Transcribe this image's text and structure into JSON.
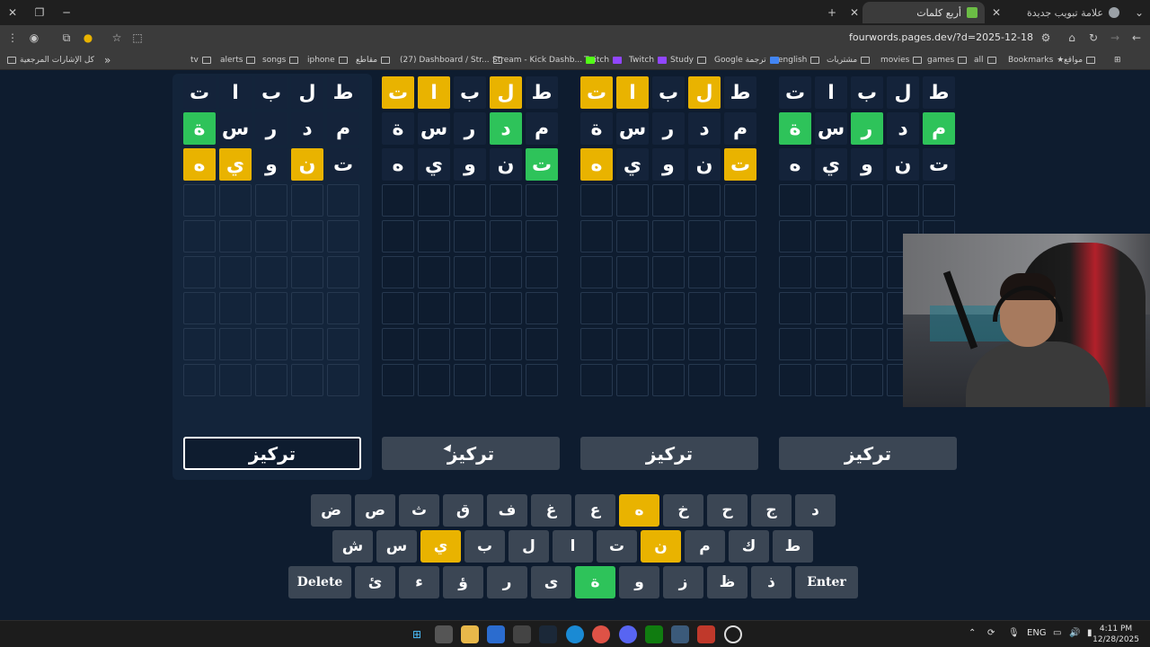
{
  "browser": {
    "tabs": [
      {
        "title": "أربع كلمات",
        "active": true,
        "icon": "puzzle-favicon"
      },
      {
        "title": "علامة تبويب جديدة",
        "active": false,
        "icon": "chrome-favicon"
      }
    ],
    "url": "fourwords.pages.dev/?d=2025-12-18",
    "bookmarks": [
      {
        "label": "Bookmarks",
        "icon": "star-icon"
      },
      {
        "label": "مواقع"
      },
      {
        "label": "all"
      },
      {
        "label": "games"
      },
      {
        "label": "movies"
      },
      {
        "label": "مشتريات"
      },
      {
        "label": "english"
      },
      {
        "label": "Google ترجمة",
        "icon": "translate"
      },
      {
        "label": "Study"
      },
      {
        "label": "Twitch",
        "icon": "twitch"
      },
      {
        "label": "Twitch",
        "icon": "twitch"
      },
      {
        "label": "Stream - Kick Dashb...",
        "icon": "kick"
      },
      {
        "label": "(27) Dashboard / Str..."
      },
      {
        "label": "مقاطع"
      },
      {
        "label": "iphone"
      },
      {
        "label": "songs"
      },
      {
        "label": "alerts"
      },
      {
        "label": "tv"
      }
    ],
    "all_bookmarks": "كل الإشارات المرجعية"
  },
  "game": {
    "boards": [
      {
        "rows": [
          [
            {
              "l": "ط",
              "s": "absent"
            },
            {
              "l": "ل",
              "s": "absent"
            },
            {
              "l": "ب",
              "s": "absent"
            },
            {
              "l": "ا",
              "s": "absent"
            },
            {
              "l": "ت",
              "s": "absent"
            }
          ],
          [
            {
              "l": "م",
              "s": "absent"
            },
            {
              "l": "د",
              "s": "absent"
            },
            {
              "l": "ر",
              "s": "absent"
            },
            {
              "l": "س",
              "s": "absent"
            },
            {
              "l": "ة",
              "s": "correct"
            }
          ],
          [
            {
              "l": "ت",
              "s": "absent"
            },
            {
              "l": "ن",
              "s": "present"
            },
            {
              "l": "و",
              "s": "absent"
            },
            {
              "l": "ي",
              "s": "present"
            },
            {
              "l": "ه",
              "s": "present"
            }
          ]
        ],
        "focus_label": "تركيز",
        "focused": true
      },
      {
        "rows": [
          [
            {
              "l": "ط",
              "s": "absent"
            },
            {
              "l": "ل",
              "s": "present"
            },
            {
              "l": "ب",
              "s": "absent"
            },
            {
              "l": "ا",
              "s": "present"
            },
            {
              "l": "ت",
              "s": "present"
            }
          ],
          [
            {
              "l": "م",
              "s": "absent"
            },
            {
              "l": "د",
              "s": "correct"
            },
            {
              "l": "ر",
              "s": "absent"
            },
            {
              "l": "س",
              "s": "absent"
            },
            {
              "l": "ة",
              "s": "absent"
            }
          ],
          [
            {
              "l": "ت",
              "s": "correct"
            },
            {
              "l": "ن",
              "s": "absent"
            },
            {
              "l": "و",
              "s": "absent"
            },
            {
              "l": "ي",
              "s": "absent"
            },
            {
              "l": "ه",
              "s": "absent"
            }
          ]
        ],
        "focus_label": "تركيز",
        "focused": false
      },
      {
        "rows": [
          [
            {
              "l": "ط",
              "s": "absent"
            },
            {
              "l": "ل",
              "s": "present"
            },
            {
              "l": "ب",
              "s": "absent"
            },
            {
              "l": "ا",
              "s": "present"
            },
            {
              "l": "ت",
              "s": "present"
            }
          ],
          [
            {
              "l": "م",
              "s": "absent"
            },
            {
              "l": "د",
              "s": "absent"
            },
            {
              "l": "ر",
              "s": "absent"
            },
            {
              "l": "س",
              "s": "absent"
            },
            {
              "l": "ة",
              "s": "absent"
            }
          ],
          [
            {
              "l": "ت",
              "s": "present"
            },
            {
              "l": "ن",
              "s": "absent"
            },
            {
              "l": "و",
              "s": "absent"
            },
            {
              "l": "ي",
              "s": "absent"
            },
            {
              "l": "ه",
              "s": "present"
            }
          ]
        ],
        "focus_label": "تركيز",
        "focused": false
      },
      {
        "rows": [
          [
            {
              "l": "ط",
              "s": "absent"
            },
            {
              "l": "ل",
              "s": "absent"
            },
            {
              "l": "ب",
              "s": "absent"
            },
            {
              "l": "ا",
              "s": "absent"
            },
            {
              "l": "ت",
              "s": "absent"
            }
          ],
          [
            {
              "l": "م",
              "s": "correct"
            },
            {
              "l": "د",
              "s": "absent"
            },
            {
              "l": "ر",
              "s": "correct"
            },
            {
              "l": "س",
              "s": "absent"
            },
            {
              "l": "ة",
              "s": "correct"
            }
          ],
          [
            {
              "l": "ت",
              "s": "absent"
            },
            {
              "l": "ن",
              "s": "absent"
            },
            {
              "l": "و",
              "s": "absent"
            },
            {
              "l": "ي",
              "s": "absent"
            },
            {
              "l": "ه",
              "s": "absent"
            }
          ]
        ],
        "focus_label": "تركيز",
        "focused": false
      }
    ],
    "total_rows": 9,
    "keyboard": [
      [
        {
          "k": "د"
        },
        {
          "k": "ج"
        },
        {
          "k": "ح"
        },
        {
          "k": "خ"
        },
        {
          "k": "ه",
          "s": "present"
        },
        {
          "k": "ع"
        },
        {
          "k": "غ"
        },
        {
          "k": "ف"
        },
        {
          "k": "ق"
        },
        {
          "k": "ث"
        },
        {
          "k": "ص"
        },
        {
          "k": "ض"
        }
      ],
      [
        {
          "k": "ط"
        },
        {
          "k": "ك"
        },
        {
          "k": "م"
        },
        {
          "k": "ن",
          "s": "present"
        },
        {
          "k": "ت"
        },
        {
          "k": "ا"
        },
        {
          "k": "ل"
        },
        {
          "k": "ب"
        },
        {
          "k": "ي",
          "s": "present"
        },
        {
          "k": "س"
        },
        {
          "k": "ش"
        }
      ],
      [
        {
          "k": "Enter",
          "wide": true
        },
        {
          "k": "ذ"
        },
        {
          "k": "ظ"
        },
        {
          "k": "ز"
        },
        {
          "k": "و"
        },
        {
          "k": "ة",
          "s": "correct"
        },
        {
          "k": "ى"
        },
        {
          "k": "ر"
        },
        {
          "k": "ؤ"
        },
        {
          "k": "ء"
        },
        {
          "k": "ئ"
        },
        {
          "k": "Delete",
          "wide": true
        }
      ]
    ]
  },
  "taskbar": {
    "lang": "ENG",
    "time": "4:11 PM",
    "date": "12/28/2025"
  },
  "colors": {
    "correct": "#2ec35a",
    "present": "#e9b300",
    "background": "#0e1c2f",
    "key": "#3b4654"
  }
}
